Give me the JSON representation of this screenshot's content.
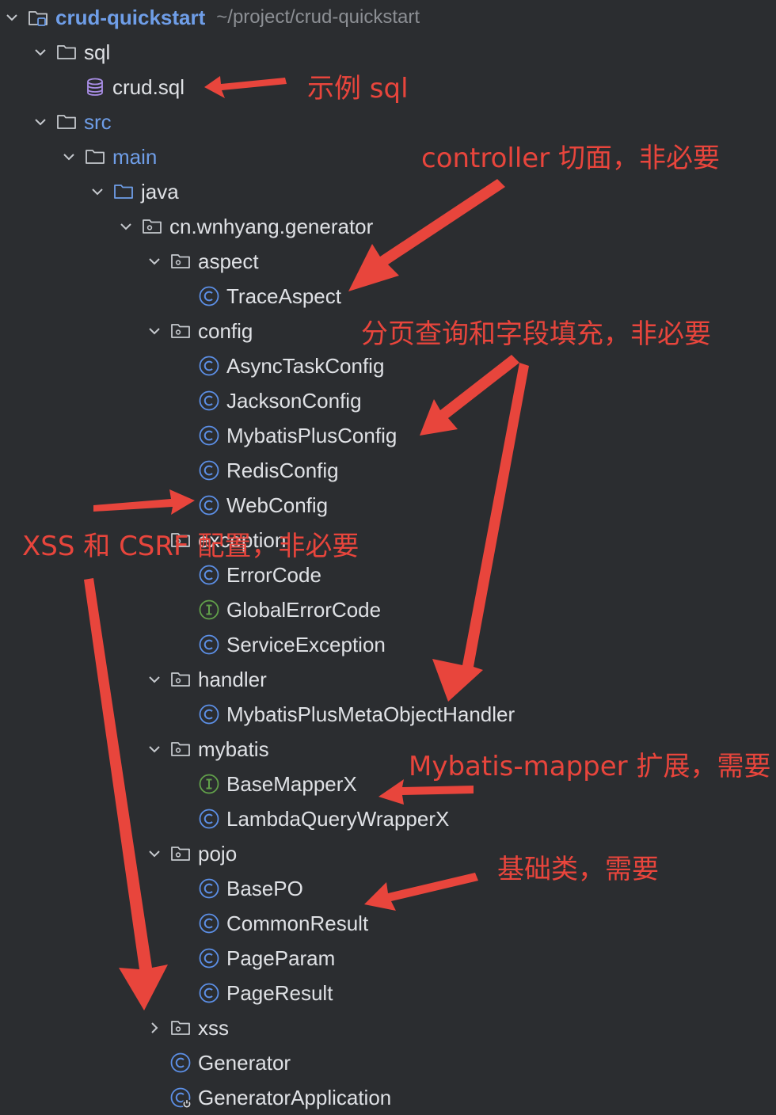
{
  "project": {
    "name": "crud-quickstart",
    "path": "~/project/crud-quickstart"
  },
  "tree": [
    {
      "label": "sql",
      "icon": "folder-icon",
      "chevron": "down",
      "kind": "folder"
    },
    {
      "label": "crud.sql",
      "icon": "database-icon",
      "chevron": "none",
      "kind": "file"
    },
    {
      "label": "src",
      "icon": "folder-icon",
      "chevron": "down",
      "kind": "source"
    },
    {
      "label": "main",
      "icon": "folder-icon",
      "chevron": "down",
      "kind": "source"
    },
    {
      "label": "java",
      "icon": "source-folder-icon",
      "chevron": "down",
      "kind": "folder"
    },
    {
      "label": "cn.wnhyang.generator",
      "icon": "package-icon",
      "chevron": "down",
      "kind": "package"
    },
    {
      "label": "aspect",
      "icon": "package-icon",
      "chevron": "down",
      "kind": "package"
    },
    {
      "label": "TraceAspect",
      "icon": "class-icon",
      "chevron": "none",
      "kind": "class"
    },
    {
      "label": "config",
      "icon": "package-icon",
      "chevron": "down",
      "kind": "package"
    },
    {
      "label": "AsyncTaskConfig",
      "icon": "class-icon",
      "chevron": "none",
      "kind": "class"
    },
    {
      "label": "JacksonConfig",
      "icon": "class-icon",
      "chevron": "none",
      "kind": "class"
    },
    {
      "label": "MybatisPlusConfig",
      "icon": "class-icon",
      "chevron": "none",
      "kind": "class"
    },
    {
      "label": "RedisConfig",
      "icon": "class-icon",
      "chevron": "none",
      "kind": "class"
    },
    {
      "label": "WebConfig",
      "icon": "class-icon",
      "chevron": "none",
      "kind": "class"
    },
    {
      "label": "exception",
      "icon": "package-icon",
      "chevron": "none",
      "kind": "package"
    },
    {
      "label": "ErrorCode",
      "icon": "class-icon",
      "chevron": "none",
      "kind": "class"
    },
    {
      "label": "GlobalErrorCode",
      "icon": "interface-icon",
      "chevron": "none",
      "kind": "interface"
    },
    {
      "label": "ServiceException",
      "icon": "class-icon",
      "chevron": "none",
      "kind": "class"
    },
    {
      "label": "handler",
      "icon": "package-icon",
      "chevron": "down",
      "kind": "package"
    },
    {
      "label": "MybatisPlusMetaObjectHandler",
      "icon": "class-icon",
      "chevron": "none",
      "kind": "class"
    },
    {
      "label": "mybatis",
      "icon": "package-icon",
      "chevron": "down",
      "kind": "package"
    },
    {
      "label": "BaseMapperX",
      "icon": "interface-icon",
      "chevron": "none",
      "kind": "interface"
    },
    {
      "label": "LambdaQueryWrapperX",
      "icon": "class-icon",
      "chevron": "none",
      "kind": "class"
    },
    {
      "label": "pojo",
      "icon": "package-icon",
      "chevron": "down",
      "kind": "package"
    },
    {
      "label": "BasePO",
      "icon": "class-icon",
      "chevron": "none",
      "kind": "class"
    },
    {
      "label": "CommonResult",
      "icon": "class-icon",
      "chevron": "none",
      "kind": "class"
    },
    {
      "label": "PageParam",
      "icon": "class-icon",
      "chevron": "none",
      "kind": "class"
    },
    {
      "label": "PageResult",
      "icon": "class-icon",
      "chevron": "none",
      "kind": "class"
    },
    {
      "label": "xss",
      "icon": "package-icon",
      "chevron": "right",
      "kind": "package"
    },
    {
      "label": "Generator",
      "icon": "class-icon",
      "chevron": "none",
      "kind": "class"
    },
    {
      "label": "GeneratorApplication",
      "icon": "spring-boot-class-icon",
      "chevron": "none",
      "kind": "class"
    }
  ],
  "annotations": {
    "sql_note": "示例 sql",
    "controller_note": "controller 切面，非必要",
    "paging_note": "分页查询和字段填充，非必要",
    "xss_note": "XSS 和 CSRF 配置，非必要",
    "mapper_note": "Mybatis-mapper 扩展，需要",
    "base_note": "基础类，需要"
  },
  "colors": {
    "background": "#2b2d30",
    "text": "#dfe1e5",
    "source_folder_text": "#6f9ee8",
    "class_icon": "#5c8fe6",
    "interface_icon": "#61a04a",
    "database_icon": "#a98ee6",
    "annotation": "#e8453c"
  }
}
